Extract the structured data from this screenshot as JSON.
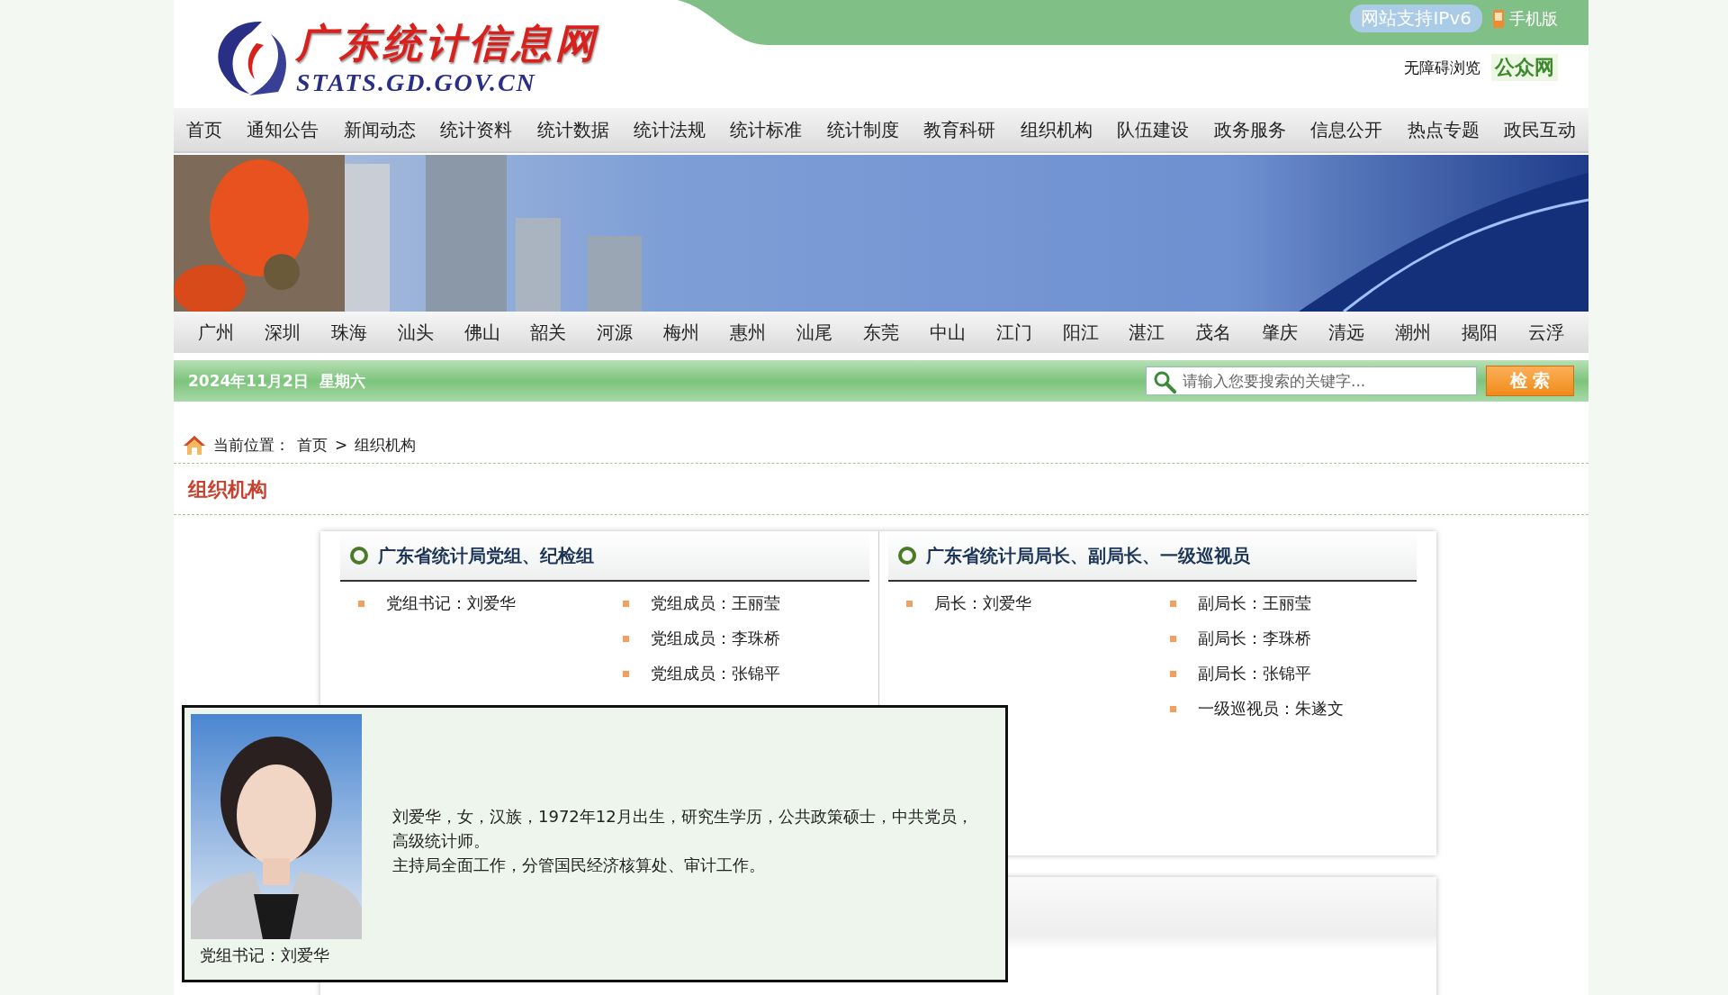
{
  "header": {
    "logo_title": "广东统计信息网",
    "logo_url": "STATS.GD.GOV.CN",
    "ipv6_badge": "网站支持IPv6",
    "mobile_link": "手机版",
    "accessibility_link": "无障碍浏览",
    "public_badge": "公众网"
  },
  "nav": [
    "首页",
    "通知公告",
    "新闻动态",
    "统计资料",
    "统计数据",
    "统计法规",
    "统计标准",
    "统计制度",
    "教育科研",
    "组织机构",
    "队伍建设",
    "政务服务",
    "信息公开",
    "热点专题",
    "政民互动"
  ],
  "cities": [
    "广州",
    "深圳",
    "珠海",
    "汕头",
    "佛山",
    "韶关",
    "河源",
    "梅州",
    "惠州",
    "汕尾",
    "东莞",
    "中山",
    "江门",
    "阳江",
    "湛江",
    "茂名",
    "肇庆",
    "清远",
    "潮州",
    "揭阳",
    "云浮"
  ],
  "date_bar": {
    "date": "2024年11月2日",
    "weekday": "星期六"
  },
  "search": {
    "placeholder": "请输入您要搜索的关键字...",
    "button": "检 索"
  },
  "breadcrumb": {
    "label": "当前位置：",
    "items": [
      "首页",
      "组织机构"
    ],
    "separator": ">"
  },
  "page_title": "组织机构",
  "sections": [
    {
      "title": "广东省统计局党组、纪检组",
      "columns": [
        [
          "党组书记：刘爱华"
        ],
        [
          "党组成员：王丽莹",
          "党组成员：李珠桥",
          "党组成员：张锦平"
        ]
      ]
    },
    {
      "title": "广东省统计局局长、副局长、一级巡视员",
      "columns": [
        [
          "局长：刘爱华"
        ],
        [
          "副局长：王丽莹",
          "副局长：李珠桥",
          "副局长：张锦平",
          "一级巡视员：朱遂文"
        ]
      ]
    }
  ],
  "popup": {
    "caption": "党组书记：刘爱华",
    "bio": [
      "刘爱华，女，汉族，1972年12月出生，研究生学历，公共政策硕士，中共党员，高级统计师。",
      "主持局全面工作，分管国民经济核算处、审计工作。"
    ]
  }
}
